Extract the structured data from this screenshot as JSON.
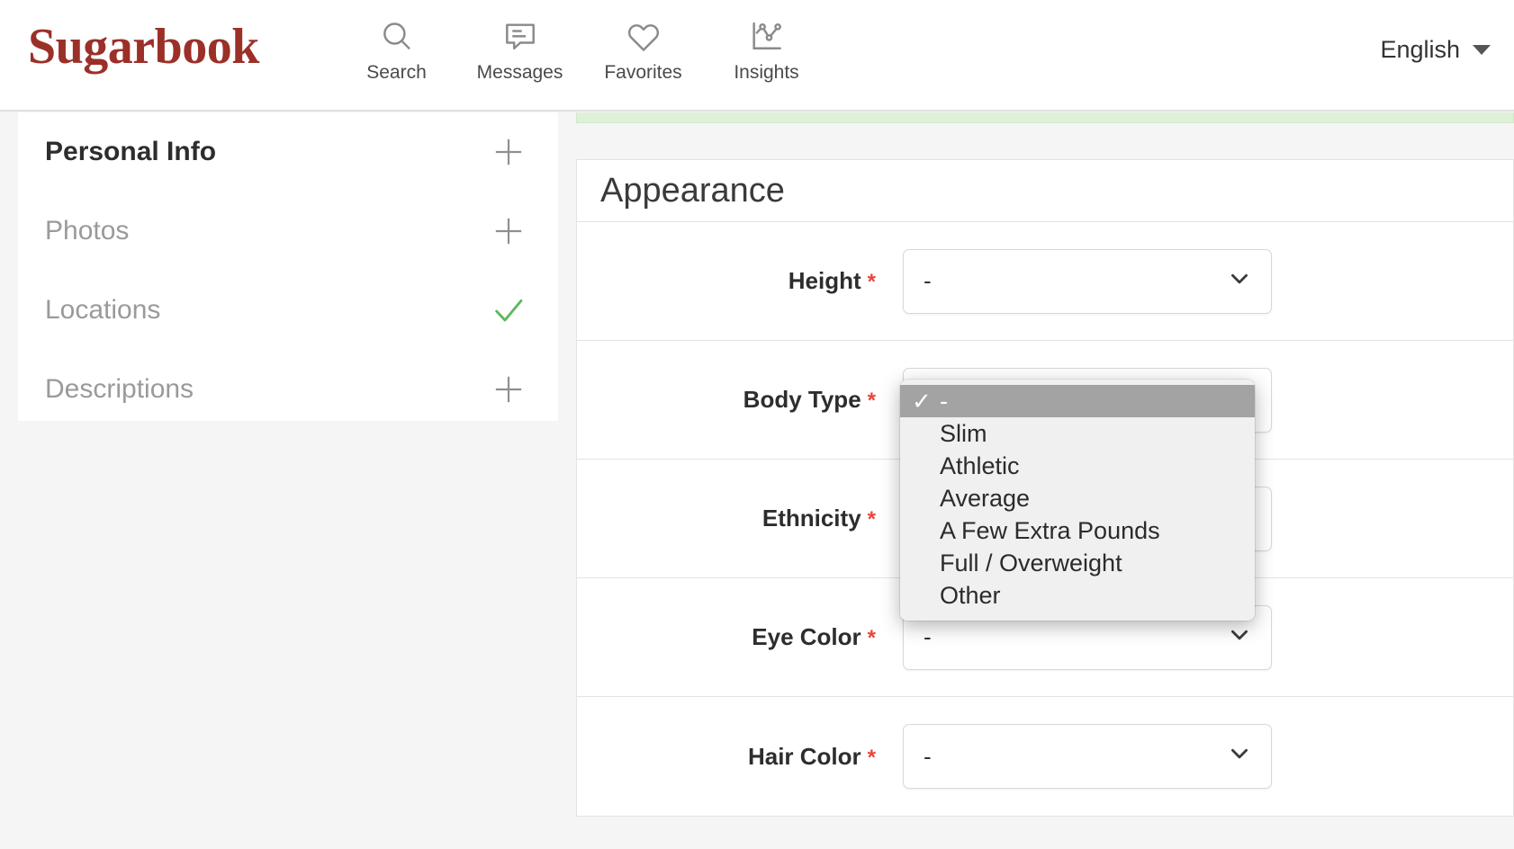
{
  "header": {
    "brand": "Sugarbook",
    "nav": [
      {
        "label": "Search",
        "icon": "search-icon"
      },
      {
        "label": "Messages",
        "icon": "messages-icon"
      },
      {
        "label": "Favorites",
        "icon": "heart-icon"
      },
      {
        "label": "Insights",
        "icon": "insights-chart-icon"
      }
    ],
    "language": {
      "label": "English",
      "caret_icon": "chevron-down-icon"
    }
  },
  "sidebar": {
    "items": [
      {
        "label": "Personal Info",
        "state": "active",
        "action_icon": "plus-icon"
      },
      {
        "label": "Photos",
        "state": "incomplete",
        "action_icon": "plus-icon"
      },
      {
        "label": "Locations",
        "state": "complete",
        "action_icon": "check-icon"
      },
      {
        "label": "Descriptions",
        "state": "incomplete",
        "action_icon": "plus-icon"
      }
    ]
  },
  "main": {
    "card_title": "Appearance",
    "fields": [
      {
        "label": "Height",
        "required": "*",
        "value": "-",
        "chevron_icon": "chevron-down-icon"
      },
      {
        "label": "Body Type",
        "required": "*",
        "value": "-",
        "chevron_icon": "chevron-down-icon"
      },
      {
        "label": "Ethnicity",
        "required": "*",
        "value": "-",
        "chevron_icon": "chevron-down-icon"
      },
      {
        "label": "Eye Color",
        "required": "*",
        "value": "-",
        "chevron_icon": "chevron-down-icon"
      },
      {
        "label": "Hair Color",
        "required": "*",
        "value": "-",
        "chevron_icon": "chevron-down-icon"
      }
    ]
  },
  "dropdown": {
    "open_for": "Body Type",
    "check_glyph": "✓",
    "options": [
      {
        "label": "-",
        "selected": true
      },
      {
        "label": "Slim",
        "selected": false
      },
      {
        "label": "Athletic",
        "selected": false
      },
      {
        "label": "Average",
        "selected": false
      },
      {
        "label": "A Few Extra Pounds",
        "selected": false
      },
      {
        "label": "Full / Overweight",
        "selected": false
      },
      {
        "label": "Other",
        "selected": false
      }
    ]
  },
  "colors": {
    "brand": "#9b3028",
    "required_asterisk": "#e8453c",
    "complete_check": "#5cb85c",
    "alert_success_bg": "#dff0d8",
    "page_bg": "#f5f5f5"
  }
}
